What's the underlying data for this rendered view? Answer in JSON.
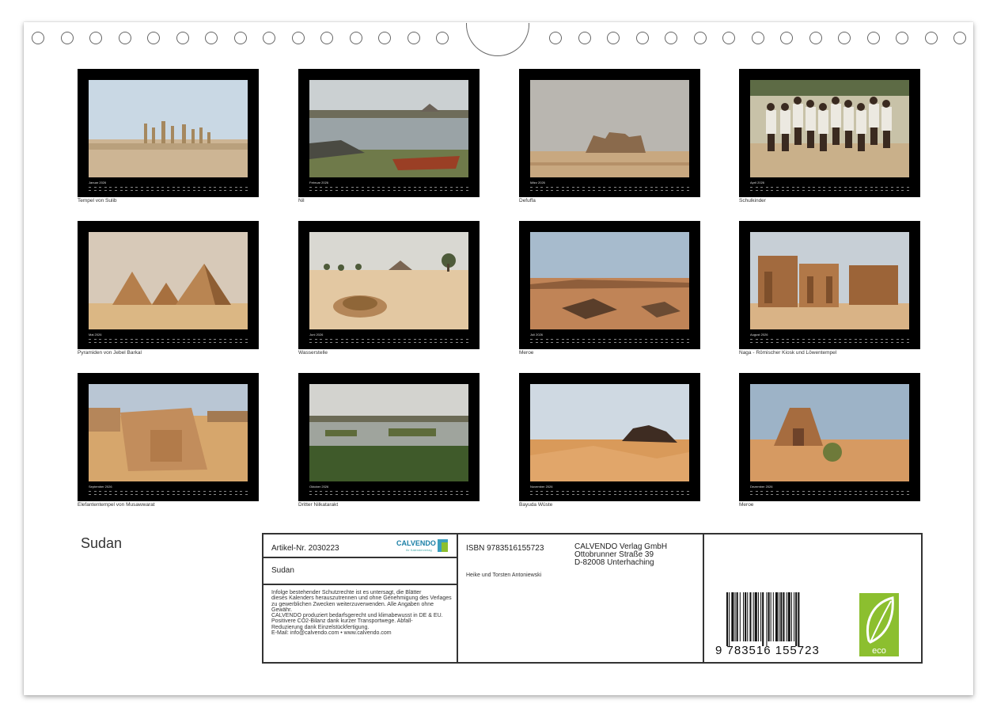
{
  "calendar": {
    "title": "Sudan",
    "months": [
      {
        "month": "Januar 2026",
        "caption": "Tempel von Sulib",
        "scene": "ruins"
      },
      {
        "month": "Februar 2026",
        "caption": "Nil",
        "scene": "river-boat"
      },
      {
        "month": "März 2026",
        "caption": "Defuffa",
        "scene": "defuffa"
      },
      {
        "month": "April 2026",
        "caption": "Schulkinder",
        "scene": "children"
      },
      {
        "month": "Mai 2026",
        "caption": "Pyramiden von Jebel Barkal",
        "scene": "pyramids"
      },
      {
        "month": "Juni 2026",
        "caption": "Wasserstelle",
        "scene": "wasserstelle"
      },
      {
        "month": "Juli 2026",
        "caption": "Meroe",
        "scene": "desert-rocks"
      },
      {
        "month": "August 2026",
        "caption": "Naga - Römischer Kiosk und Löwentempel",
        "scene": "naga"
      },
      {
        "month": "September 2026",
        "caption": "Elefantentempel von Musawwarat",
        "scene": "elephant"
      },
      {
        "month": "Oktober 2026",
        "caption": "Dritter Nilkatarakt",
        "scene": "katarakt"
      },
      {
        "month": "November 2026",
        "caption": "Bayuda Wüste",
        "scene": "dunes"
      },
      {
        "month": "Dezember 2026",
        "caption": "Meroe",
        "scene": "pyramid-single"
      }
    ]
  },
  "info": {
    "artikel": "Artikel-Nr. 2030223",
    "logo": "CALVENDO",
    "logo_sub": "Ihr Kalenderverlag",
    "title": "Sudan",
    "legal": [
      "Infolge bestehender Schutzrechte ist es untersagt, die Blätter",
      "dieses Kalenders herauszutrennen und ohne Genehmigung des Verlages",
      "zu gewerblichen Zwecken weiterzuverwenden. Alle Angaben ohne",
      "Gewähr.",
      "CALVENDO produziert bedarfsgerecht und klimabewusst in DE & EU.",
      "Positivere CO2-Bilanz dank kurzer Transportwege. Abfall-",
      "Reduzierung dank Einzelstückfertigung.",
      "E-Mail: info@calvendo.com • www.calvendo.com"
    ],
    "isbn": "ISBN 9783516155723",
    "publisher": [
      "CALVENDO Verlag GmbH",
      "Ottobrunner Straße 39",
      "D-82008 Unterhaching"
    ],
    "authors": "Heike und Torsten Antoniewski",
    "barcode_number": "9 783516 155723",
    "eco_label": "eco"
  },
  "colors": {
    "frame": "#000000",
    "eco_green": "#8cbf2f",
    "sand": "#d9b382",
    "sky": "#b9c9d6"
  }
}
